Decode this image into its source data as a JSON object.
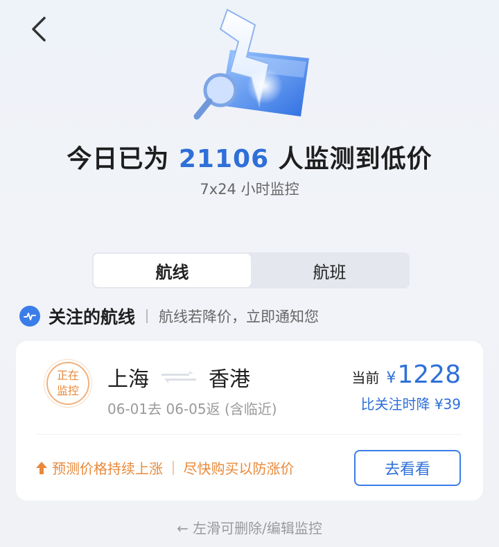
{
  "header": {
    "back_icon": "chevron-left-icon"
  },
  "hero": {
    "illustration": "lightning-magnifier-illustration",
    "headline_prefix": "今日已为 ",
    "headline_count": "21106",
    "headline_suffix": " 人监测到低价",
    "subline": "7x24 小时监控"
  },
  "tabs": [
    {
      "label": "航线",
      "active": true
    },
    {
      "label": "航班",
      "active": false
    }
  ],
  "section": {
    "icon": "pulse-icon",
    "title": "关注的航线",
    "desc": "航线若降价，立即通知您"
  },
  "card": {
    "badge": "正在监控",
    "origin": "上海",
    "destination": "香港",
    "dates": "06-01去 06-05返 (含临近)",
    "price_label": "当前",
    "currency": "¥",
    "price": "1228",
    "drop_text": "比关注时降 ¥39",
    "trend_text": "预测价格持续上涨",
    "advice_text": "尽快购买以防涨价",
    "button": "去看看"
  },
  "hint": "← 左滑可删除/编辑监控",
  "colors": {
    "accent": "#2e6fd8",
    "warning": "#e8893a"
  }
}
